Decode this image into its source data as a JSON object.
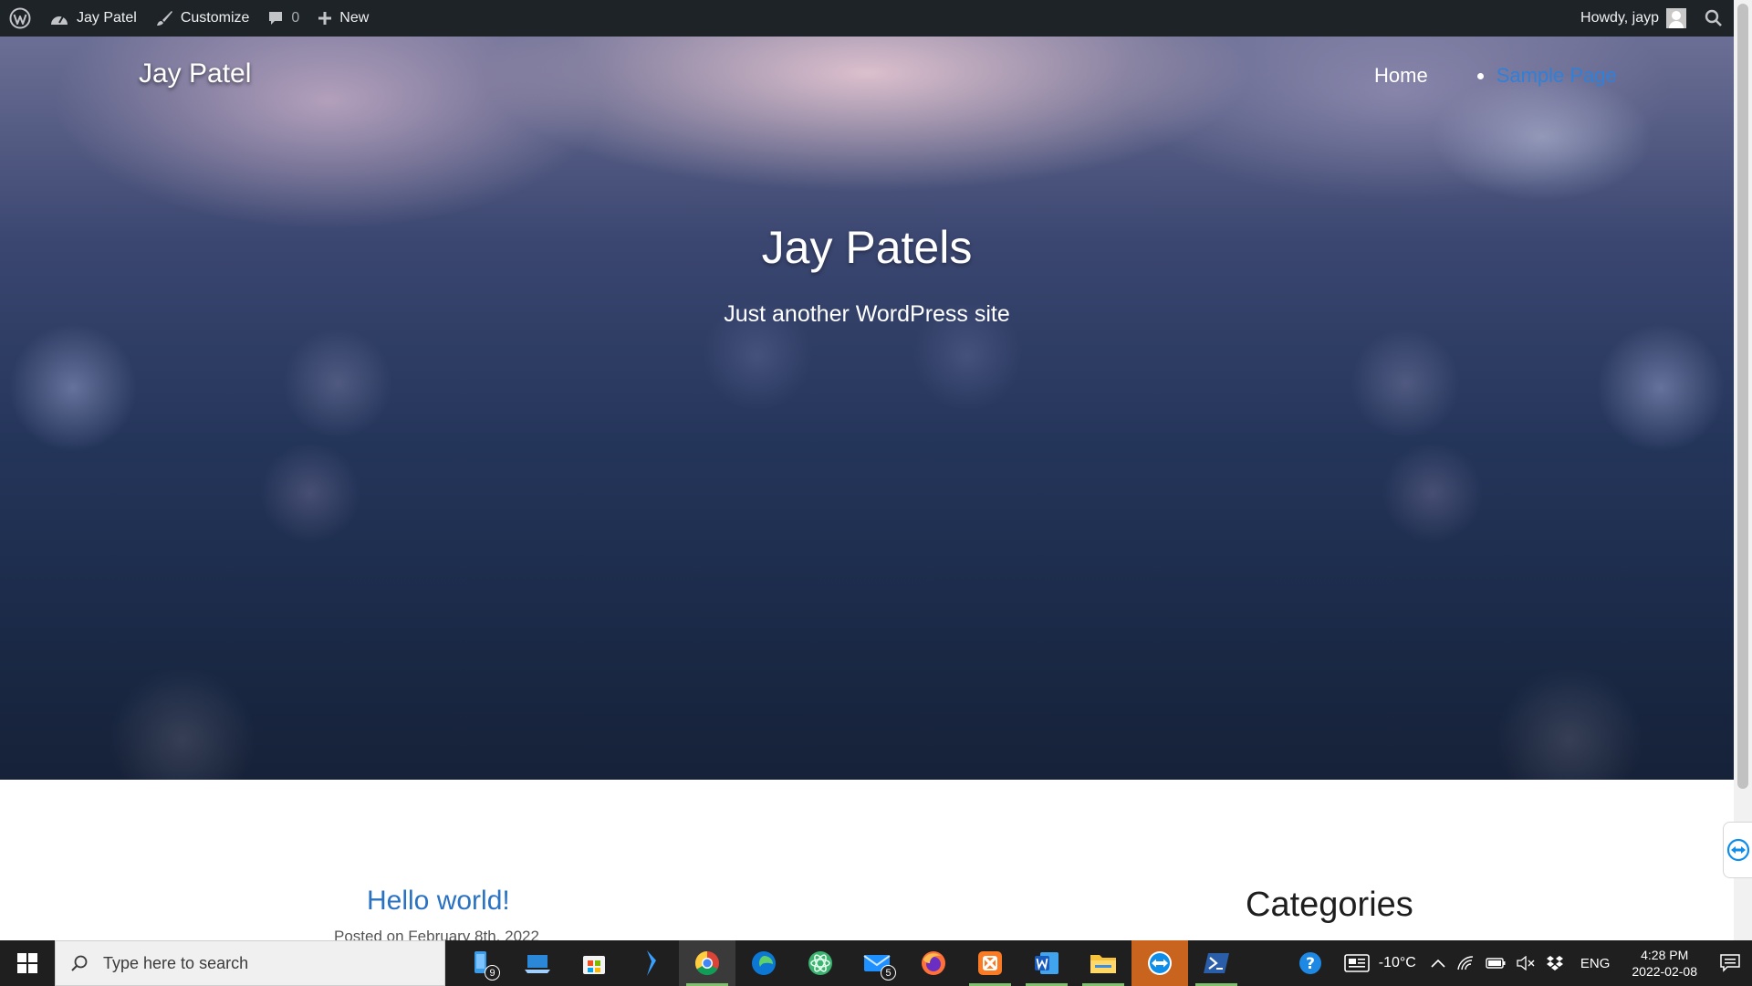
{
  "adminbar": {
    "site_name": "Jay Patel",
    "customize": "Customize",
    "comments_count": "0",
    "new_label": "New",
    "howdy": "Howdy, jayp"
  },
  "header": {
    "logo": "Jay Patel",
    "nav": [
      {
        "label": "Home",
        "color": "#ffffff"
      },
      {
        "label": "Sample Page",
        "color": "#2f80d9"
      }
    ],
    "title": "Jay Patels",
    "tagline": "Just another WordPress site"
  },
  "content": {
    "post_title": "Hello world!",
    "post_meta": "Posted on February 8th, 2022",
    "widget_title": "Categories"
  },
  "taskbar": {
    "search_placeholder": "Type here to search",
    "apps": [
      {
        "icon": "phone-link-icon",
        "badge": "9"
      },
      {
        "icon": "remote-desktop-icon"
      },
      {
        "icon": "microsoft-store-icon"
      },
      {
        "icon": "azure-data-studio-icon"
      },
      {
        "icon": "chrome-icon",
        "running": true,
        "active": true
      },
      {
        "icon": "edge-icon"
      },
      {
        "icon": "atom-icon"
      },
      {
        "icon": "mail-icon",
        "badge": "5"
      },
      {
        "icon": "firefox-icon"
      },
      {
        "icon": "xampp-icon",
        "running": true
      },
      {
        "icon": "word-icon",
        "running": true
      },
      {
        "icon": "file-explorer-icon",
        "running": true
      },
      {
        "icon": "teamviewer-icon",
        "highlight": true
      },
      {
        "icon": "powershell-icon",
        "running": true
      }
    ],
    "weather": "-10°C",
    "language": "ENG",
    "time": "4:28 PM",
    "date": "2022-02-08"
  },
  "colors": {
    "adminbar_bg": "#1d2327",
    "link": "#2a72c2",
    "taskbar_bg": "#1f1f1f"
  }
}
